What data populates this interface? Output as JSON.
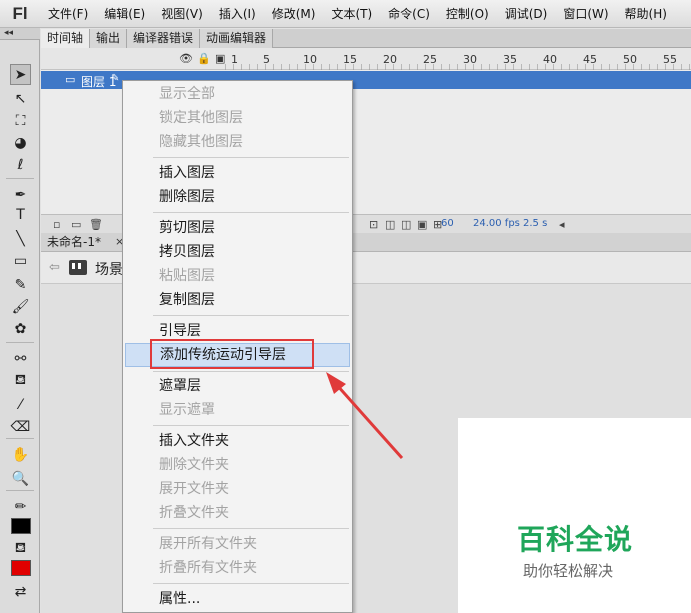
{
  "app": {
    "logo": "Fl"
  },
  "menubar": {
    "items": [
      "文件(F)",
      "编辑(E)",
      "视图(V)",
      "插入(I)",
      "修改(M)",
      "文本(T)",
      "命令(C)",
      "控制(O)",
      "调试(D)",
      "窗口(W)",
      "帮助(H)"
    ]
  },
  "toolpanel": {
    "collapse": "◂◂"
  },
  "tabs": [
    "时间轴",
    "输出",
    "编译器错误",
    "动画编辑器"
  ],
  "timeline": {
    "frame_numbers": [
      "1",
      "5",
      "10",
      "15",
      "20",
      "25",
      "30",
      "35",
      "40",
      "45",
      "50",
      "55"
    ],
    "layer": {
      "name": "图层 1"
    },
    "footer": {
      "frame": "60",
      "fps": "24.00 fps",
      "time": "2.5 s"
    }
  },
  "document": {
    "tab": "未命名-1*",
    "tab_close": "×",
    "scene": "场景"
  },
  "context_menu": {
    "items": [
      {
        "label": "显示全部",
        "enabled": false
      },
      {
        "label": "锁定其他图层",
        "enabled": false
      },
      {
        "label": "隐藏其他图层",
        "enabled": false
      },
      {
        "label": "插入图层",
        "enabled": true
      },
      {
        "label": "删除图层",
        "enabled": true
      },
      {
        "label": "剪切图层",
        "enabled": true
      },
      {
        "label": "拷贝图层",
        "enabled": true
      },
      {
        "label": "粘贴图层",
        "enabled": false
      },
      {
        "label": "复制图层",
        "enabled": true
      },
      {
        "label": "引导层",
        "enabled": true
      },
      {
        "label": "添加传统运动引导层",
        "enabled": true,
        "hover": true
      },
      {
        "label": "遮罩层",
        "enabled": true
      },
      {
        "label": "显示遮罩",
        "enabled": false
      },
      {
        "label": "插入文件夹",
        "enabled": true
      },
      {
        "label": "删除文件夹",
        "enabled": false
      },
      {
        "label": "展开文件夹",
        "enabled": false
      },
      {
        "label": "折叠文件夹",
        "enabled": false
      },
      {
        "label": "展开所有文件夹",
        "enabled": false
      },
      {
        "label": "折叠所有文件夹",
        "enabled": false
      },
      {
        "label": "属性...",
        "enabled": true
      }
    ]
  },
  "watermark": {
    "title": "百科全说",
    "subtitle": "助你轻松解决"
  },
  "colors": {
    "annotation": "#e03a3a",
    "layer_selected": "#3f78c7",
    "watermark": "#1fa65a",
    "fill_swatch": "#e00000",
    "stroke_swatch": "#000000"
  }
}
